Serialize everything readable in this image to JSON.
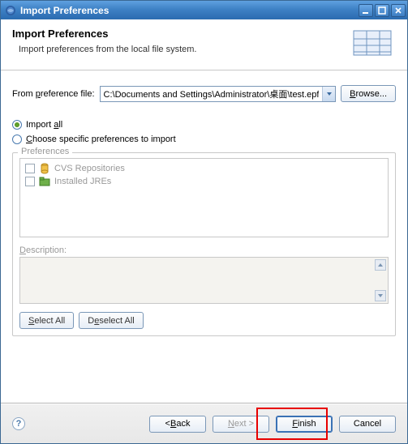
{
  "titlebar": {
    "title": "Import Preferences"
  },
  "banner": {
    "title": "Import Preferences",
    "subtitle": "Import preferences from the local file system."
  },
  "form": {
    "file_label": "From preference file:",
    "file_value": "C:\\Documents and Settings\\Administrator\\桌面\\test.epf",
    "browse_label": "Browse..."
  },
  "options": {
    "import_all": "Import all",
    "choose_specific": "Choose specific preferences to import"
  },
  "prefs_group": {
    "legend": "Preferences",
    "items": [
      {
        "label": "CVS Repositories",
        "icon": "cylinder"
      },
      {
        "label": "Installed JREs",
        "icon": "folder"
      }
    ],
    "description_label": "Description:",
    "select_all": "Select All",
    "deselect_all": "Deselect All"
  },
  "footer": {
    "back": "< Back",
    "next": "Next >",
    "finish": "Finish",
    "cancel": "Cancel"
  }
}
